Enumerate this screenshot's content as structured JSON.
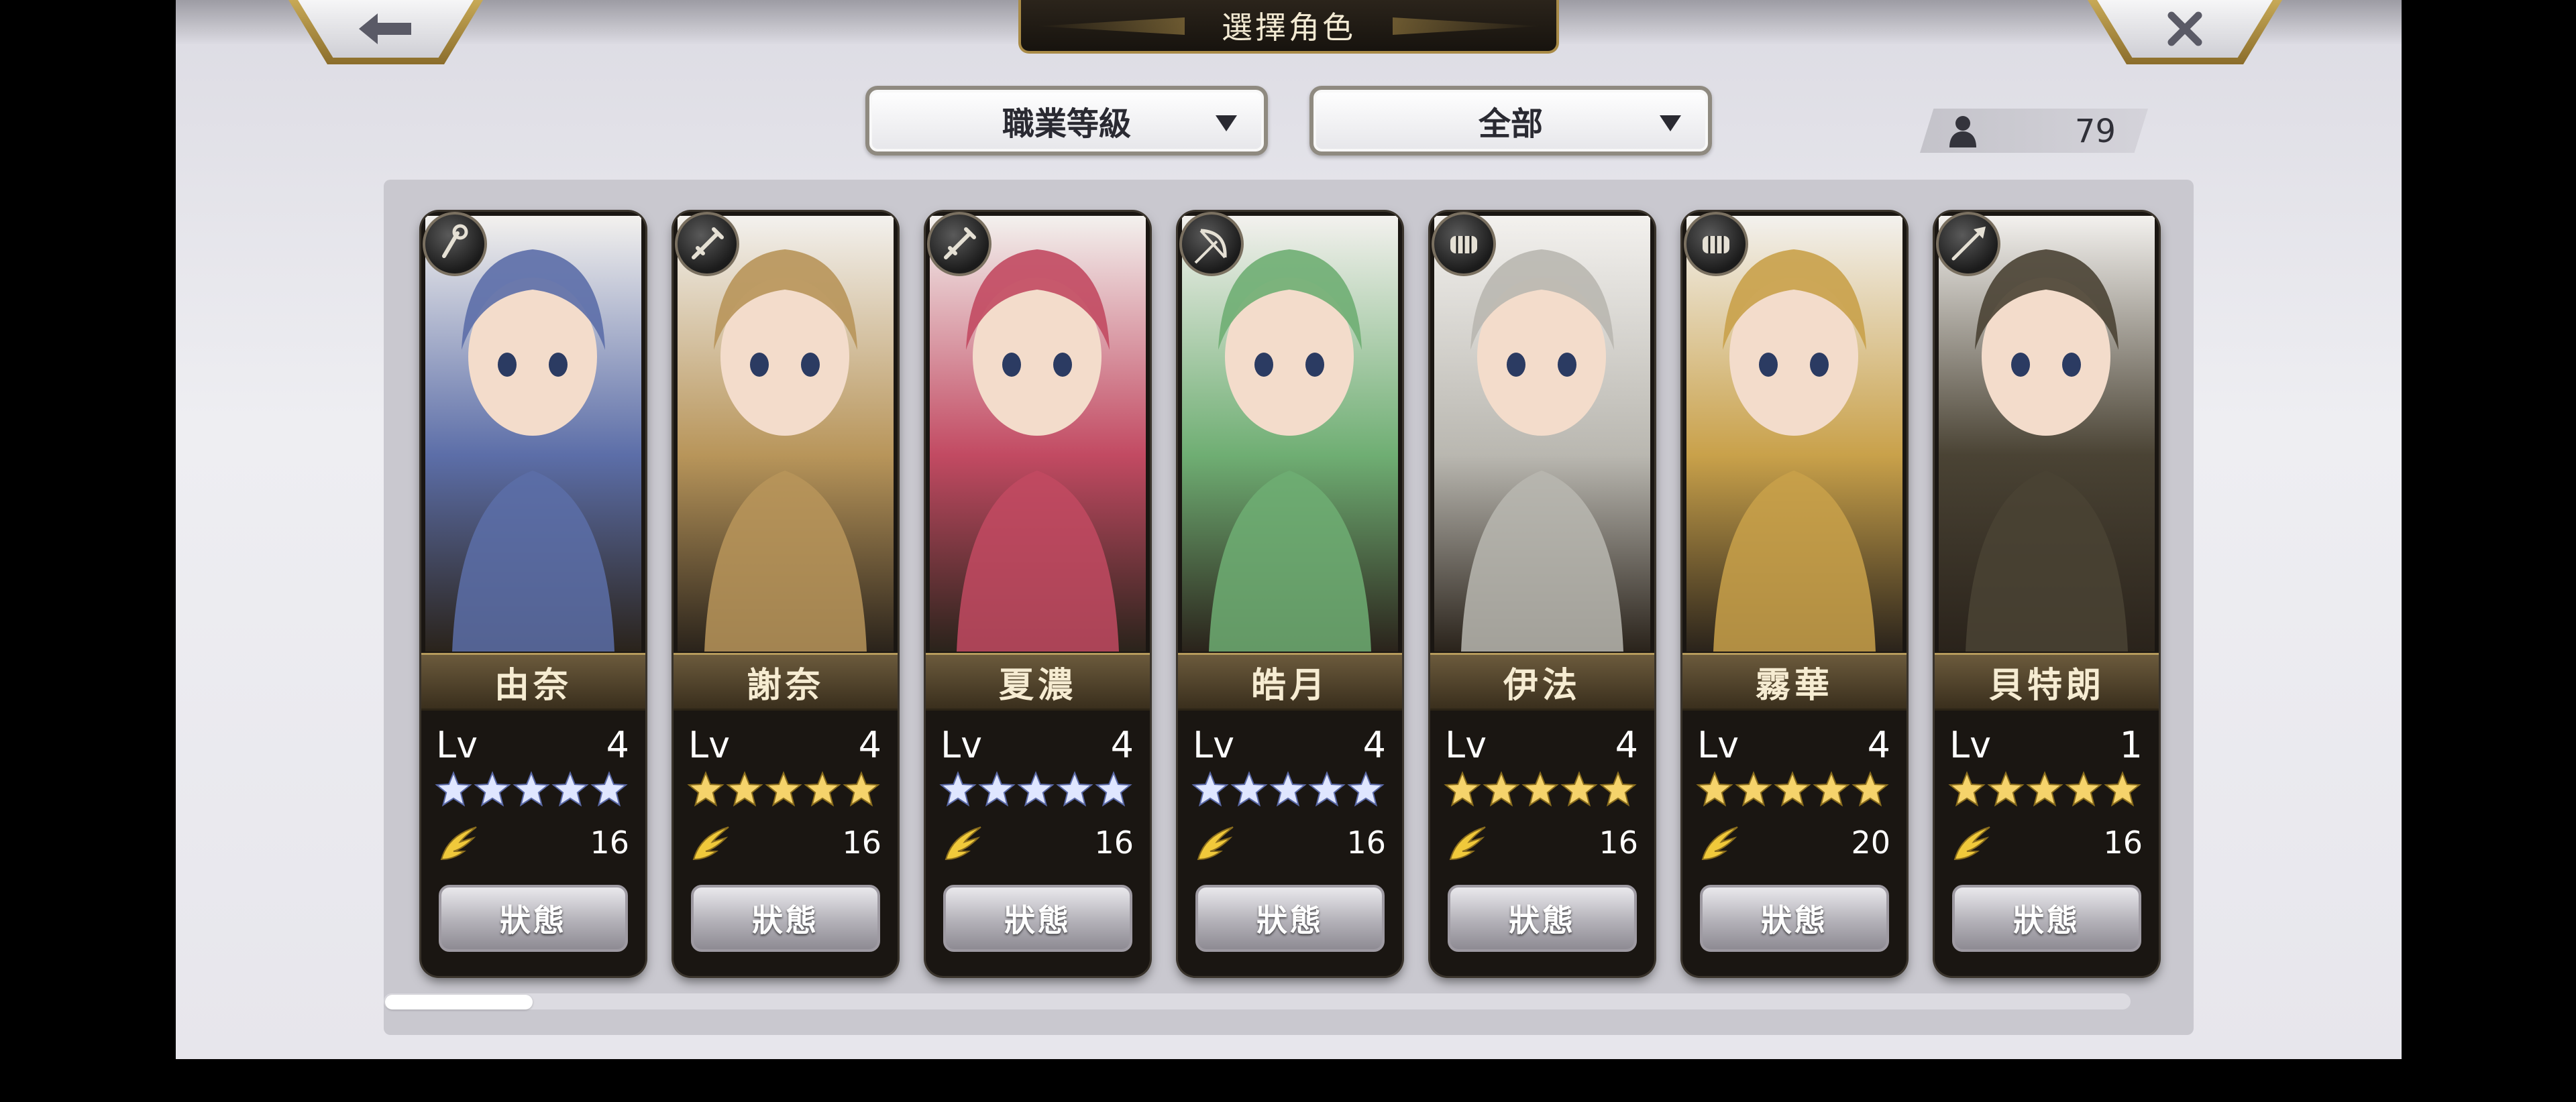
{
  "header": {
    "title": "選擇角色",
    "back_icon": "arrow-left-icon",
    "close_icon": "close-x-icon"
  },
  "filters": {
    "sort_by": "職業等級",
    "filter": "全部"
  },
  "character_count": "79",
  "colors": {
    "silver_star": "#dfe6ff",
    "gold_star": "#f5d36b",
    "frame_gold": "#b59a5c",
    "energy_gold": "#f0c93b"
  },
  "characters": [
    {
      "name": "由奈",
      "lv_label": "Lv",
      "level": "4",
      "stars": 5,
      "star_color": "silver",
      "class_icon": "staff-icon",
      "energy": "16",
      "status": "狀態",
      "bg": "#5c6ea8"
    },
    {
      "name": "謝奈",
      "lv_label": "Lv",
      "level": "4",
      "stars": 5,
      "star_color": "gold",
      "class_icon": "sword-icon",
      "energy": "16",
      "status": "狀態",
      "bg": "#b8955a"
    },
    {
      "name": "夏濃",
      "lv_label": "Lv",
      "level": "4",
      "stars": 5,
      "star_color": "silver",
      "class_icon": "sword-icon",
      "energy": "16",
      "status": "狀態",
      "bg": "#c24a62"
    },
    {
      "name": "皓月",
      "lv_label": "Lv",
      "level": "4",
      "stars": 5,
      "star_color": "silver",
      "class_icon": "bow-icon",
      "energy": "16",
      "status": "狀態",
      "bg": "#6fae73"
    },
    {
      "name": "伊法",
      "lv_label": "Lv",
      "level": "4",
      "stars": 5,
      "star_color": "gold",
      "class_icon": "fist-icon",
      "energy": "16",
      "status": "狀態",
      "bg": "#b9b7b0"
    },
    {
      "name": "霧華",
      "lv_label": "Lv",
      "level": "4",
      "stars": 5,
      "star_color": "gold",
      "class_icon": "fist-icon",
      "energy": "20",
      "status": "狀態",
      "bg": "#c9a14a"
    },
    {
      "name": "貝特朗",
      "lv_label": "Lv",
      "level": "1",
      "stars": 5,
      "star_color": "gold",
      "class_icon": "spear-icon",
      "energy": "16",
      "status": "狀態",
      "bg": "#4a4334"
    }
  ]
}
